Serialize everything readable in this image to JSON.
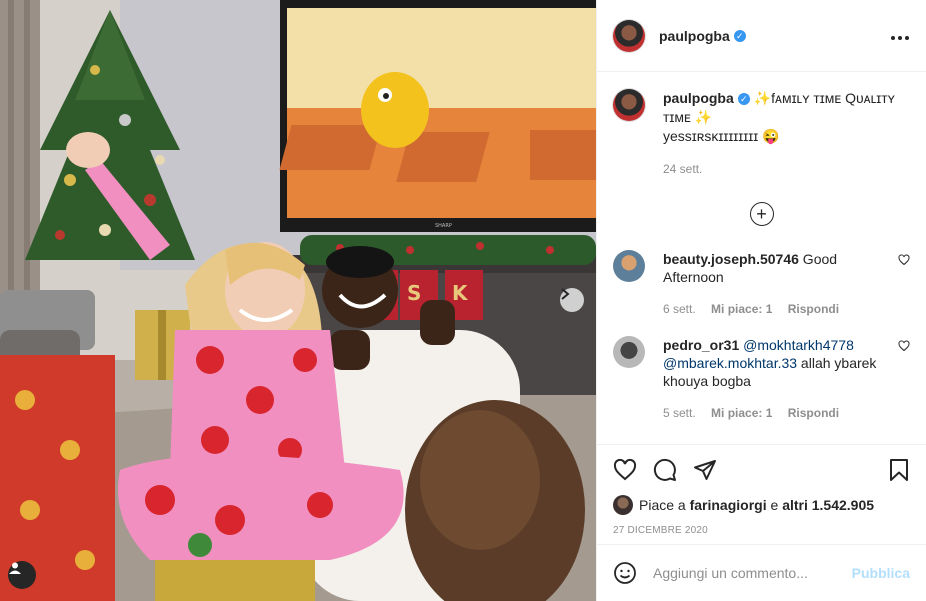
{
  "photo": {
    "tv_brand": "SHARP"
  },
  "post": {
    "username": "paulpogba",
    "verified_mark": "✓",
    "more_icon": "more-dots-icon",
    "caption_line1": "✨fᴀᴍɪʟʏ ᴛɪᴍᴇ Qᴜᴀʟɪᴛʏ ᴛɪᴍᴇ ✨",
    "caption_line2": "yessɪʀsᴋɪɪɪɪɪɪɪɪ 😜",
    "time": "24 sett.",
    "load_more_symbol": "+"
  },
  "comments": [
    {
      "user": "beauty.joseph.50746",
      "text": " Good Afternoon",
      "time": "6 sett.",
      "likes": "Mi piace: 1",
      "reply": "Rispondi"
    },
    {
      "user": "pedro_or31",
      "mention1": "@mokhtarkh4778",
      "mention2": "@mbarek.mokhtar.33",
      "text": " allah ybarek khouya bogba",
      "time": "5 sett.",
      "likes": "Mi piace: 1",
      "reply": "Rispondi"
    }
  ],
  "actions": {
    "likes_prefix": "Piace a ",
    "likes_user": "farinagiorgi",
    "likes_mid": " e ",
    "likes_others": "altri 1.542.905",
    "date": "27 DICEMBRE 2020"
  },
  "composer": {
    "placeholder": "Aggiungi un commento...",
    "publish": "Pubblica"
  },
  "colors": {
    "verified": "#3897f0",
    "link": "#00376b",
    "muted": "#8e8e8e",
    "publish_disabled": "#b2dffc"
  }
}
